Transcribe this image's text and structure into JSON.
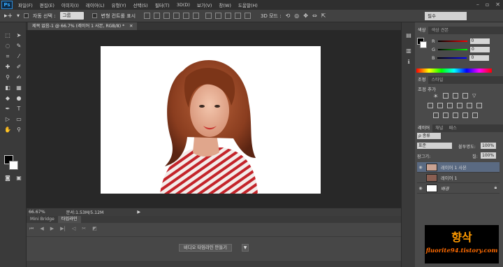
{
  "app": {
    "logo_text": "Ps"
  },
  "menu": [
    "파일(F)",
    "편집(E)",
    "이미지(I)",
    "레이어(L)",
    "유형(Y)",
    "선택(S)",
    "필터(T)",
    "3D(D)",
    "보기(V)",
    "창(W)",
    "도움말(H)"
  ],
  "options": {
    "auto_select_label": "자동 선택 :",
    "auto_select_value": "그룹",
    "transform_label": "변형 컨트롤 표시",
    "mode_label": "3D 모드 :",
    "workspace": "필수"
  },
  "document": {
    "tab_title": "제목 없음-1 @ 66.7% (레이어 1 사본, RGB/8) *",
    "zoom": "66.67%",
    "doc_info": "문서:1.53M/5.12M"
  },
  "timeline": {
    "tabs": [
      "Mini Bridge",
      "타임라인"
    ],
    "active_tab": 1,
    "create_button": "비디오 타임라인 만들기"
  },
  "color_panel": {
    "tabs": [
      "색상",
      "색상 견본"
    ],
    "channels": [
      {
        "label": "R",
        "value": "0"
      },
      {
        "label": "G",
        "value": "0"
      },
      {
        "label": "B",
        "value": "0"
      }
    ]
  },
  "adjust_panel": {
    "tabs": [
      "조정",
      "스타일"
    ],
    "title": "조정 추가"
  },
  "layers_panel": {
    "tabs": [
      "레이어",
      "채널",
      "패스"
    ],
    "filter_label": "ρ 종류",
    "blend_mode": "표준",
    "opacity_label": "불투명도:",
    "opacity_value": "100%",
    "lock_label": "잠그기:",
    "fill_label": "칠:",
    "fill_value": "100%",
    "layers": [
      {
        "name": "레이어 1 사본",
        "selected": true
      },
      {
        "name": "레이어 1",
        "selected": false
      },
      {
        "name": "배경",
        "selected": false
      }
    ]
  },
  "watermark": {
    "title": "향삭",
    "subtitle": "fluorite94.tistory.com"
  },
  "colors": {
    "accent": "#31a8ff",
    "selected_layer": "#5a6a82",
    "foreground": "#000000",
    "background": "#ffffff"
  }
}
